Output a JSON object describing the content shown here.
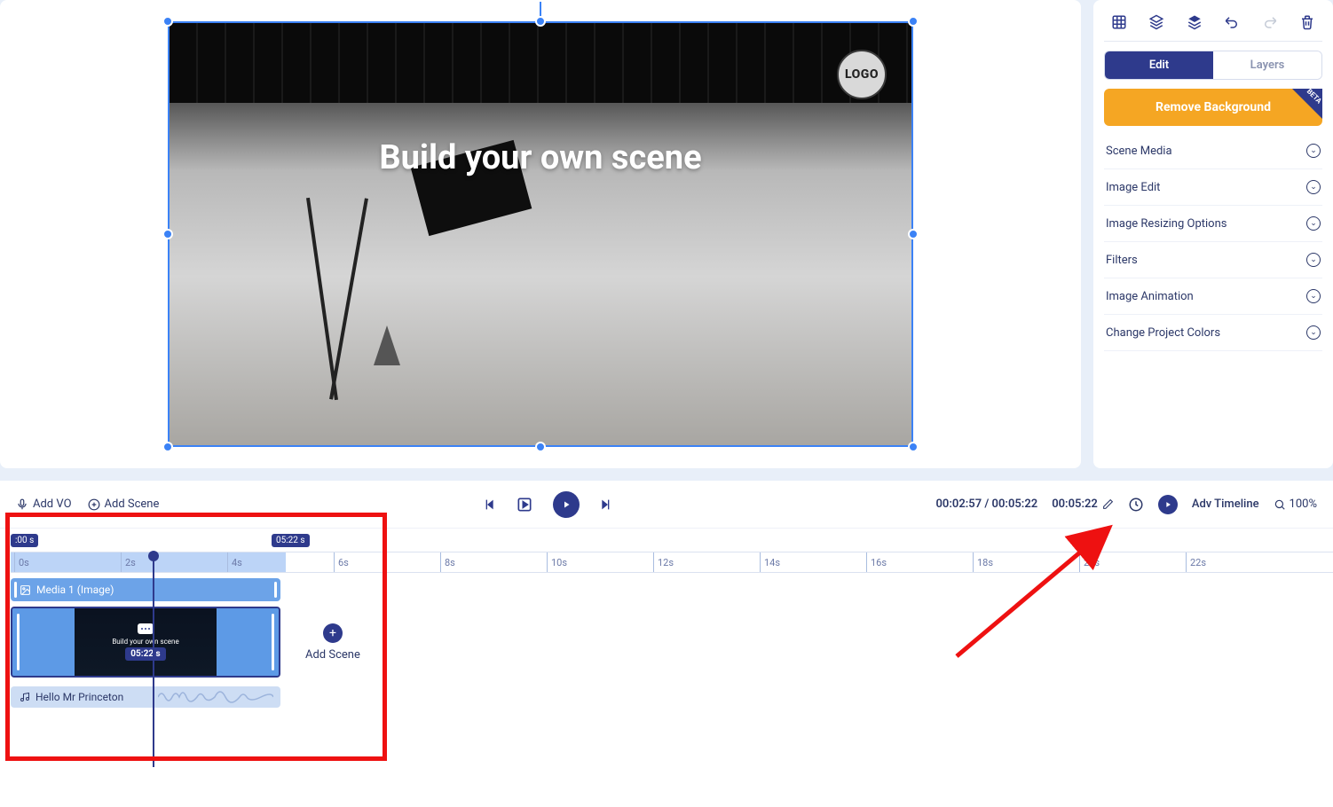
{
  "canvas": {
    "overlay_text": "Build your own scene",
    "logo_label": "LOGO"
  },
  "right_panel": {
    "tabs": {
      "edit": "Edit",
      "layers": "Layers"
    },
    "remove_bg": "Remove Background",
    "beta": "BETA",
    "sections": [
      "Scene Media",
      "Image Edit",
      "Image Resizing Options",
      "Filters",
      "Image Animation",
      "Change Project Colors"
    ]
  },
  "controls": {
    "add_vo": "Add VO",
    "add_scene_top": "Add Scene",
    "time_progress": "00:02:57 / 00:05:22",
    "time_total": "00:05:22",
    "adv_timeline": "Adv Timeline",
    "zoom": "100%"
  },
  "timeline": {
    "badge_start": ":00 s",
    "badge_end": "05:22 s",
    "ticks": [
      "0s",
      "2s",
      "4s",
      "6s",
      "8s",
      "10s",
      "12s",
      "14s",
      "16s",
      "18s",
      "20s",
      "22s"
    ],
    "media_label": "Media 1 (Image)",
    "scene_title": "Build your own scene",
    "scene_duration": "05:22 s",
    "add_scene": "Add Scene",
    "audio_label": "Hello Mr Princeton"
  }
}
